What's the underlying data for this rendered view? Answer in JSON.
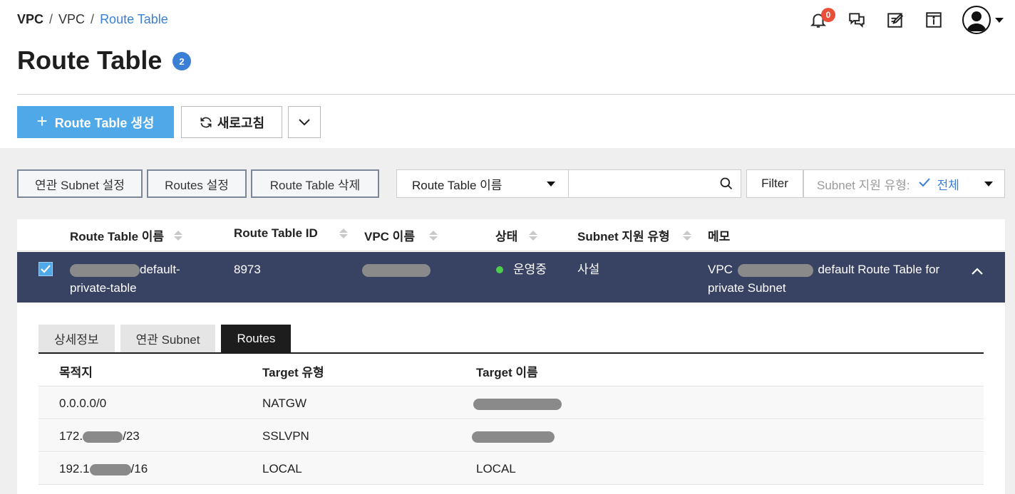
{
  "breadcrumb": {
    "root": "VPC",
    "parent": "VPC",
    "current": "Route Table",
    "sep": "/"
  },
  "header": {
    "notification_count": "0"
  },
  "page": {
    "title": "Route Table",
    "count": "2"
  },
  "toolbar": {
    "create_label": "Route Table 생성",
    "refresh_label": "새로고침"
  },
  "actions": {
    "assoc_subnet": "연관 Subnet 설정",
    "routes": "Routes 설정",
    "delete": "Route Table 삭제"
  },
  "search": {
    "field": "Route Table 이름",
    "placeholder": ""
  },
  "filter": {
    "button": "Filter",
    "label": "Subnet 지원 유형:",
    "value": "전체"
  },
  "table": {
    "columns": [
      "Route Table 이름",
      "Route Table ID",
      "VPC 이름",
      "상태",
      "Subnet 지원 유형",
      "메모"
    ],
    "row": {
      "name_suffix": "default-",
      "name_line2": "private-table",
      "id": "8973",
      "status": "운영중",
      "subnet_type": "사설",
      "memo_prefix": "VPC",
      "memo_suffix": "default Route Table for",
      "memo_line2": "private Subnet"
    }
  },
  "detail": {
    "tabs": [
      "상세정보",
      "연관 Subnet",
      "Routes"
    ],
    "columns": [
      "목적지",
      "Target 유형",
      "Target 이름"
    ],
    "rows": [
      {
        "dest": "0.0.0.0/0",
        "type": "NATGW",
        "name": ""
      },
      {
        "dest_prefix": "172.",
        "dest_suffix": "/23",
        "type": "SSLVPN",
        "name": ""
      },
      {
        "dest_prefix": "192.1",
        "dest_suffix": "/16",
        "type": "LOCAL",
        "name": "LOCAL"
      }
    ]
  },
  "colors": {
    "accent": "#4fa8e8",
    "link": "#3a7fd5",
    "selected_row": "#384263",
    "status_running": "#4cce4c",
    "badge": "#e8503a"
  }
}
